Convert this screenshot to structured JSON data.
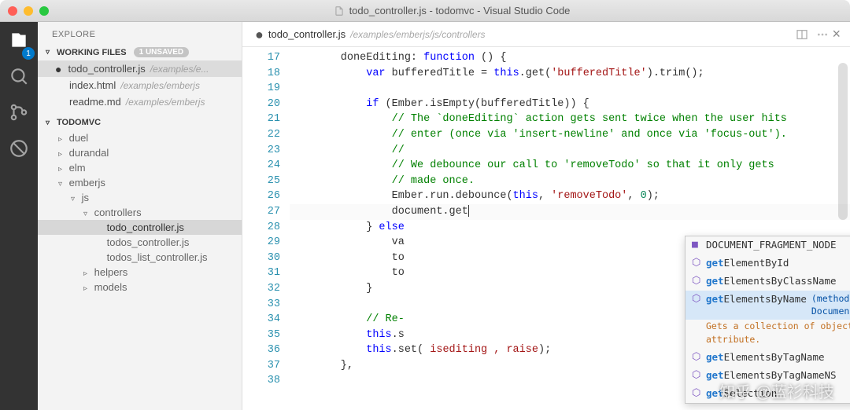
{
  "titlebar": {
    "text": "todo_controller.js - todomvc - Visual Studio Code"
  },
  "activity": {
    "badge": "1"
  },
  "sidebar": {
    "title": "EXPLORE",
    "working": {
      "label": "WORKING FILES",
      "badge": "1 UNSAVED"
    },
    "workingFiles": [
      {
        "name": "todo_controller.js",
        "path": "/examples/e...",
        "dirty": true,
        "selected": true
      },
      {
        "name": "index.html",
        "path": "/examples/emberjs",
        "dirty": false
      },
      {
        "name": "readme.md",
        "path": "/examples/emberjs",
        "dirty": false
      }
    ],
    "project": "TODOMVC",
    "tree": [
      {
        "depth": 1,
        "exp": "▹",
        "label": "duel"
      },
      {
        "depth": 1,
        "exp": "▹",
        "label": "durandal"
      },
      {
        "depth": 1,
        "exp": "▹",
        "label": "elm"
      },
      {
        "depth": 1,
        "exp": "▿",
        "label": "emberjs"
      },
      {
        "depth": 2,
        "exp": "▿",
        "label": "js"
      },
      {
        "depth": 3,
        "exp": "▿",
        "label": "controllers"
      },
      {
        "depth": 4,
        "exp": "",
        "label": "todo_controller.js",
        "selected": true
      },
      {
        "depth": 4,
        "exp": "",
        "label": "todos_controller.js"
      },
      {
        "depth": 4,
        "exp": "",
        "label": "todos_list_controller.js"
      },
      {
        "depth": 3,
        "exp": "▹",
        "label": "helpers"
      },
      {
        "depth": 3,
        "exp": "▹",
        "label": "models"
      }
    ]
  },
  "tab": {
    "name": "todo_controller.js",
    "breadcrumb": "/examples/emberjs/js/controllers"
  },
  "lines": [
    {
      "n": 17,
      "html": "        doneEditing: <span class='k'>function</span> () {"
    },
    {
      "n": 18,
      "bp": true,
      "html": "            <span class='k'>var</span> bufferedTitle = <span class='this'>this</span>.get(<span class='s'>'bufferedTitle'</span>).trim();"
    },
    {
      "n": 19,
      "html": ""
    },
    {
      "n": 20,
      "html": "            <span class='k'>if</span> (Ember.isEmpty(bufferedTitle)) {"
    },
    {
      "n": 21,
      "html": "                <span class='c'>// The `doneEditing` action gets sent twice when the user hits</span>"
    },
    {
      "n": 22,
      "html": "                <span class='c'>// enter (once via 'insert-newline' and once via 'focus-out').</span>"
    },
    {
      "n": 23,
      "html": "                <span class='c'>//</span>"
    },
    {
      "n": 24,
      "html": "                <span class='c'>// We debounce our call to 'removeTodo' so that it only gets</span>"
    },
    {
      "n": 25,
      "html": "                <span class='c'>// made once.</span>"
    },
    {
      "n": 26,
      "bp": true,
      "html": "                Ember.run.debounce(<span class='this'>this</span>, <span class='s'>'removeTodo'</span>, <span class='num'>0</span>);"
    },
    {
      "n": 27,
      "cursor": true,
      "html": "                document.get<span class='caret'></span>"
    },
    {
      "n": 28,
      "html": "            } <span class='k'>else</span>"
    },
    {
      "n": 29,
      "html": "                va"
    },
    {
      "n": 30,
      "html": "                to"
    },
    {
      "n": 31,
      "html": "                to"
    },
    {
      "n": 32,
      "html": "            }"
    },
    {
      "n": 33,
      "html": ""
    },
    {
      "n": 34,
      "html": "            <span class='c'>// Re-</span>"
    },
    {
      "n": 35,
      "html": "            <span class='this'>this</span>.s"
    },
    {
      "n": 36,
      "html": "            <span class='this'>this</span>.set(<span class='s'> isediting , raise</span>);"
    },
    {
      "n": 37,
      "html": "        },"
    },
    {
      "n": 38,
      "html": ""
    }
  ],
  "suggest": {
    "items": [
      {
        "kind": "■",
        "pre": "",
        "match": "",
        "post": "DOCUMENT_FRAGMENT_NODE"
      },
      {
        "kind": "⬡",
        "pre": "",
        "match": "get",
        "post": "ElementById"
      },
      {
        "kind": "⬡",
        "pre": "",
        "match": "get",
        "post": "ElementsByClassName"
      },
      {
        "kind": "⬡",
        "pre": "",
        "match": "get",
        "post": "ElementsByName",
        "sel": true,
        "docLabel": "(method) Document.getElementsByName(elementName:",
        "docDesc": "Gets a collection of objects based on the value of the NAME or ID attribute."
      },
      {
        "kind": "⬡",
        "pre": "",
        "match": "get",
        "post": "ElementsByTagName"
      },
      {
        "kind": "⬡",
        "pre": "",
        "match": "get",
        "post": "ElementsByTagNameNS"
      },
      {
        "kind": "⬡",
        "pre": "",
        "match": "get",
        "post": "Selection"
      }
    ]
  },
  "watermark": "知乎 @蓝衫科技"
}
